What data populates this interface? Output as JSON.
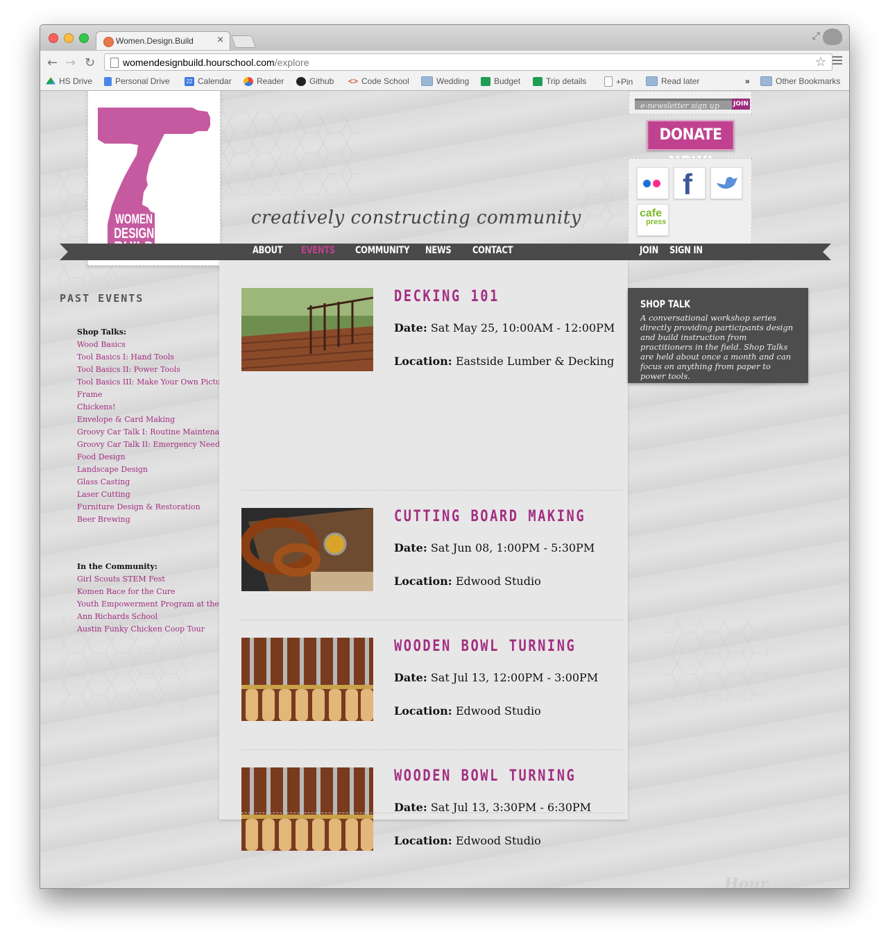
{
  "browser": {
    "tab_title": "Women.Design.Build",
    "tab_close": "×",
    "url_host": "womendesignbuild.hourschool.com",
    "url_path": "/explore",
    "back_icon": "←",
    "forward_icon": "→",
    "reload_icon": "↻",
    "star_icon": "☆",
    "bookmarks": [
      {
        "label": "HS Drive",
        "icon": "drive-icon"
      },
      {
        "label": "Personal Drive",
        "icon": "docs-icon"
      },
      {
        "label": "Calendar",
        "icon": "calendar-icon",
        "badge": "22"
      },
      {
        "label": "Reader",
        "icon": "reader-icon"
      },
      {
        "label": "Github",
        "icon": "github-icon"
      },
      {
        "label": "Code School",
        "icon": "code-icon",
        "glyph": "<>"
      },
      {
        "label": "Wedding",
        "icon": "folder-icon"
      },
      {
        "label": "Budget",
        "icon": "sheet-icon"
      },
      {
        "label": "Trip details",
        "icon": "sheet-icon"
      },
      {
        "label": "+Pin",
        "icon": "page-icon"
      },
      {
        "label": "Read later",
        "icon": "folder-icon"
      }
    ],
    "more_bookmarks": "»",
    "other_bookmarks": "Other Bookmarks"
  },
  "header": {
    "logo_lines": [
      "WOMEN",
      "DESIGN",
      "BUILD"
    ],
    "tagline": "creatively constructing community",
    "newsletter_placeholder": "e-newsletter sign up",
    "newsletter_join": "JOIN",
    "donate": "DONATE NOW!",
    "social": {
      "cafepress_line1": "cafe",
      "cafepress_line2": "press"
    }
  },
  "nav": {
    "items": [
      "ABOUT",
      "EVENTS",
      "COMMUNITY",
      "NEWS",
      "CONTACT"
    ],
    "active": "EVENTS",
    "join": "JOIN",
    "sign_in": "SIGN IN"
  },
  "sidebar": {
    "title": "PAST EVENTS",
    "groups": [
      {
        "heading": "Shop Talks:",
        "links": [
          "Wood Basics",
          "Tool Basics I: Hand Tools",
          "Tool Basics II: Power Tools",
          "Tool Basics III: Make Your Own Picture",
          "Frame",
          "Chickens!",
          "Envelope & Card Making",
          "Groovy Car Talk I: Routine Maintenance",
          "Groovy Car Talk II: Emergency Needs",
          "Food Design",
          "Landscape Design",
          "Glass Casting",
          "Laser Cutting",
          "Furniture Design & Restoration",
          "Beer Brewing"
        ]
      },
      {
        "heading": "In the Community:",
        "links": [
          "Girl Scouts STEM Fest",
          "Komen Race for the Cure",
          "Youth Empowerment Program at the",
          "Ann Richards School",
          "Austin Funky Chicken Coop Tour"
        ]
      }
    ]
  },
  "events": {
    "date_label": "Date:",
    "location_label": "Location:",
    "items": [
      {
        "title": "DECKING 101",
        "date": "Sat May 25, 10:00AM - 12:00PM",
        "location": "Eastside Lumber & Decking",
        "image": "deck"
      },
      {
        "title": "CUTTING BOARD MAKING",
        "date": "Sat Jun 08, 1:00PM - 5:30PM",
        "location": "Edwood Studio",
        "image": "pretzel"
      },
      {
        "title": "WOODEN BOWL TURNING",
        "date": "Sat Jul 13, 12:00PM - 3:00PM",
        "location": "Edwood Studio",
        "image": "chisels"
      },
      {
        "title": "WOODEN BOWL TURNING",
        "date": "Sat Jul 13, 3:30PM - 6:30PM",
        "location": "Edwood Studio",
        "image": "chisels"
      }
    ]
  },
  "shop_talk": {
    "title": "SHOP TALK",
    "body": "A conversational workshop series directly providing participants design and build instruction from practitioners in the field. Shop Talks are held about once a month and can focus on anything from paper to power tools."
  },
  "footer": {
    "watermark": "Hour"
  },
  "colors": {
    "accent": "#a32e82",
    "donate": "#c0418f",
    "nav_bg": "#4a4a4a",
    "shop_talk_bg": "#4d4d4d"
  }
}
